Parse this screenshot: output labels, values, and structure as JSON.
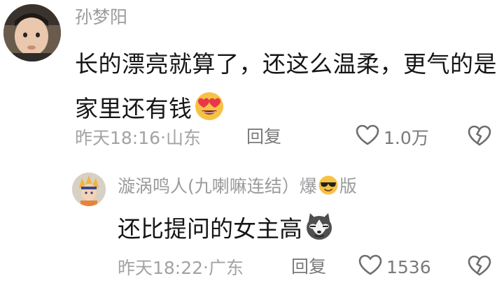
{
  "comment": {
    "username": "孙梦阳",
    "text": "长的漂亮就算了，还这么温柔，更气的是家里还有钱",
    "emoji": "heart-eyes-emoji",
    "time": "昨天18:16",
    "separator": " · ",
    "location": "山东",
    "reply_label": "回复",
    "like_count": "1.0万"
  },
  "reply": {
    "username_prefix": "漩涡鸣人(九喇嘛连结）爆",
    "username_suffix": "版",
    "name_emoji": "sunglasses-emoji",
    "text": "还比提问的女主高",
    "emoji": "husky-dog-emoji",
    "time": "昨天18:22",
    "separator": " · ",
    "location": "广东",
    "reply_label": "回复",
    "like_count": "1536"
  },
  "colors": {
    "meta_text": "#a3a3a3",
    "username": "#9b9b9b",
    "body_text": "#161616"
  }
}
